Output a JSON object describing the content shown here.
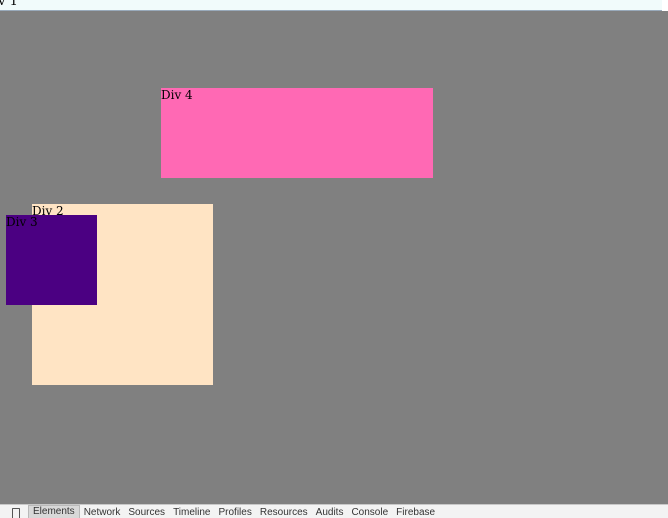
{
  "page": {
    "div1_label": "iv 1"
  },
  "boxes": {
    "div4": {
      "label": "Div 4",
      "color": "#ff69b4"
    },
    "div2": {
      "label": "Div 2",
      "color": "#ffe4c4"
    },
    "div3": {
      "label": "Div 3",
      "color": "#4b0082"
    },
    "div1": {
      "color": "#808080"
    }
  },
  "devtools": {
    "tabs": [
      {
        "label": "Elements",
        "active": true
      },
      {
        "label": "Network"
      },
      {
        "label": "Sources"
      },
      {
        "label": "Timeline"
      },
      {
        "label": "Profiles"
      },
      {
        "label": "Resources"
      },
      {
        "label": "Audits"
      },
      {
        "label": "Console"
      },
      {
        "label": "Firebase"
      }
    ]
  }
}
